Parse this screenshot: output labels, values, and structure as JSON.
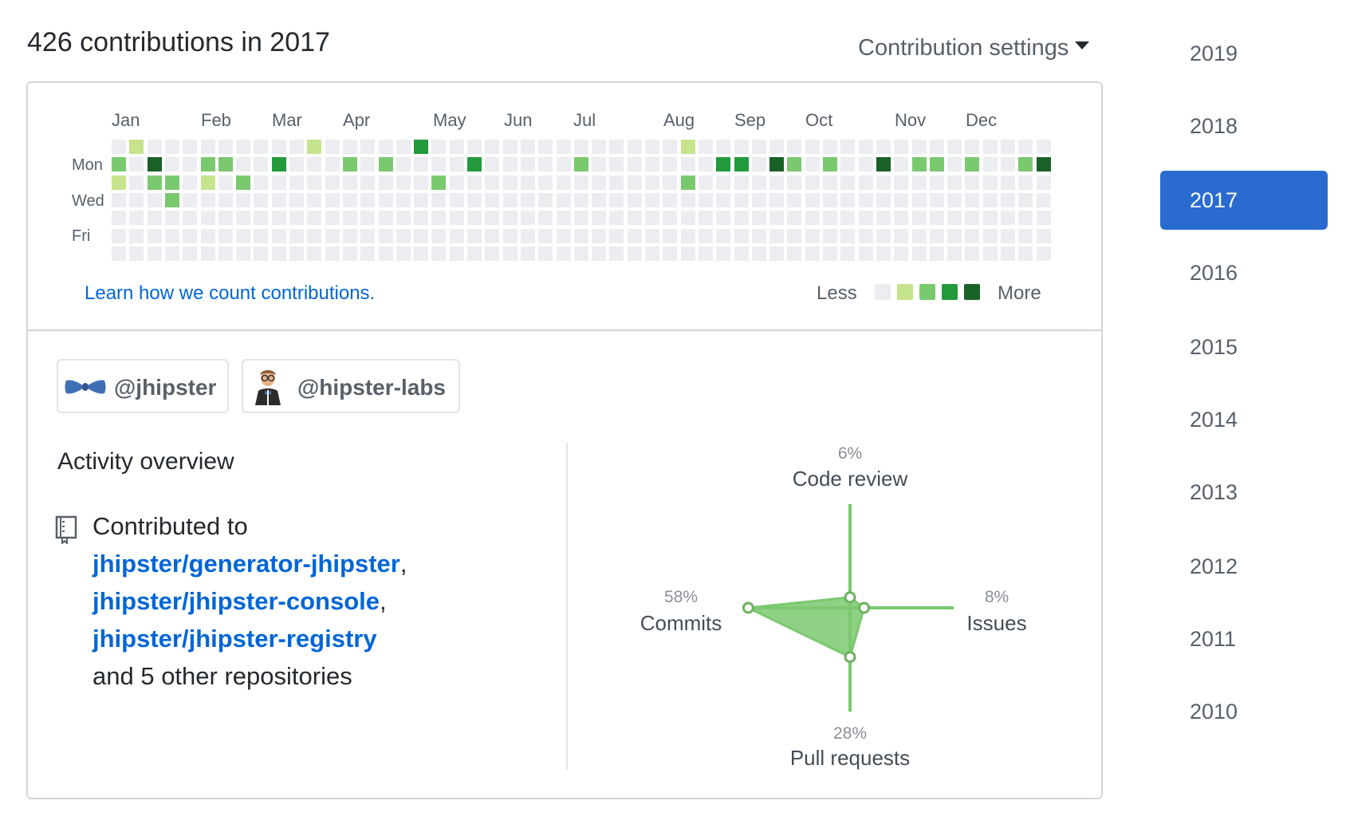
{
  "header": {
    "title": "426 contributions in 2017",
    "settings_label": "Contribution settings"
  },
  "calendar": {
    "months": [
      "Jan",
      "Feb",
      "Mar",
      "Apr",
      "May",
      "Jun",
      "Jul",
      "Aug",
      "Sep",
      "Oct",
      "Nov",
      "Dec"
    ],
    "day_labels": [
      "Mon",
      "Wed",
      "Fri"
    ],
    "learn_link": "Learn how we count contributions.",
    "legend_less": "Less",
    "legend_more": "More",
    "level_colors": [
      "#ebedf0",
      "#c6e48b",
      "#7bc96f",
      "#239a3b",
      "#196127"
    ],
    "grid_rows": [
      "01000000000100000300000000000000100000000000000000000000000",
      "20400220030002020000300000200000003304202004022020024220000",
      "10220102000000000020000000000000200000000000000000000000000",
      "00020000000000000000000000000000000000000000000000000000000",
      "00000000000000000000000000000000000000000000000000000000000",
      "00000000000000000000000000000000000000000000000000000000000",
      "00000000000000000000000000000000000000000000000000000000000"
    ]
  },
  "orgs": [
    {
      "name": "@jhipster",
      "icon": "bowtie-icon"
    },
    {
      "name": "@hipster-labs",
      "icon": "hipster-avatar-icon"
    }
  ],
  "activity": {
    "title": "Activity overview",
    "contributed_to": "Contributed to",
    "repos": [
      "jhipster/generator-jhipster",
      "jhipster/jhipster-console",
      "jhipster/jhipster-registry"
    ],
    "others": "and 5 other repositories",
    "radar": {
      "code_review": {
        "label": "Code review",
        "pct": "6%",
        "value": 6
      },
      "issues": {
        "label": "Issues",
        "pct": "8%",
        "value": 8
      },
      "pull_requests": {
        "label": "Pull requests",
        "pct": "28%",
        "value": 28
      },
      "commits": {
        "label": "Commits",
        "pct": "58%",
        "value": 58
      }
    }
  },
  "years": [
    "2019",
    "2018",
    "2017",
    "2016",
    "2015",
    "2014",
    "2013",
    "2012",
    "2011",
    "2010"
  ],
  "selected_year": "2017"
}
